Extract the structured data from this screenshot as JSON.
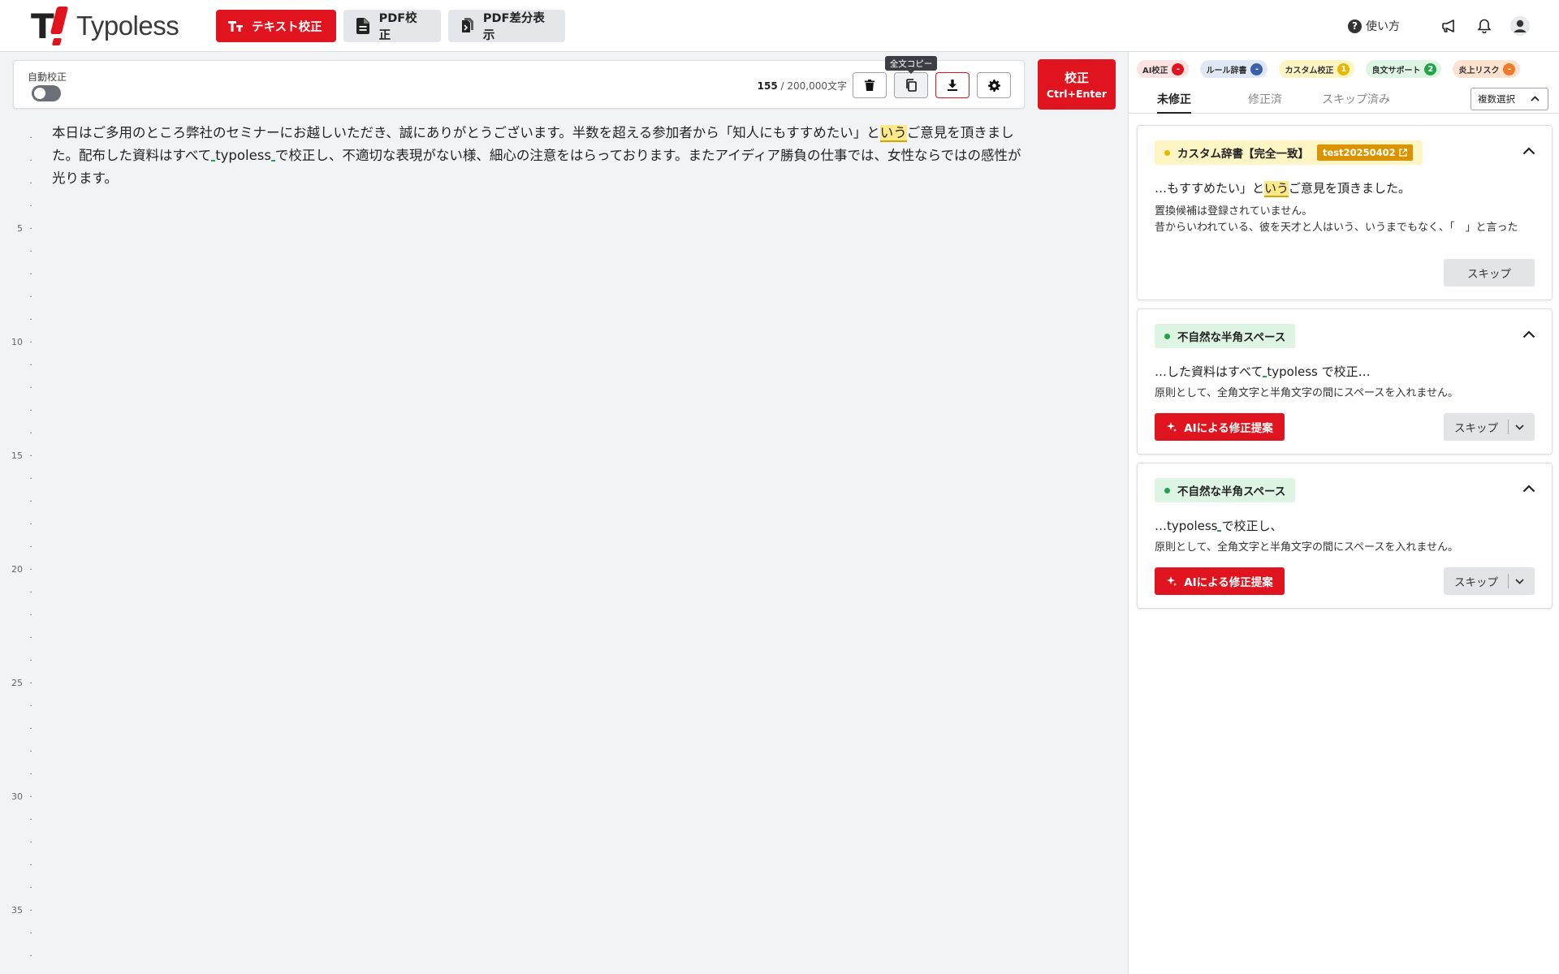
{
  "header": {
    "logo_text": "Typoless",
    "nav": [
      {
        "label": "テキスト校正",
        "icon": "text-proofread-icon"
      },
      {
        "label": "PDF校正",
        "icon": "pdf-file-icon"
      },
      {
        "label": "PDF差分表示",
        "icon": "pdf-diff-icon"
      }
    ],
    "help_label": "使い方"
  },
  "toolbar": {
    "auto_label": "自動校正",
    "auto_enabled": false,
    "char_count": "155",
    "char_limit": "/ 200,000文字",
    "tooltip": "全文コピー",
    "submit_label": "校正",
    "submit_shortcut": "Ctrl+Enter"
  },
  "editor": {
    "line_numbers": [
      "5",
      "10",
      "15",
      "20",
      "25",
      "30",
      "35"
    ],
    "text": {
      "p1": "本日はご多用のところ弊社のセミナーにお越しいただき、誠にありがとうございます。半数を超える参加者から「知人にもすすめたい」と",
      "p1_hl": "いう",
      "p1_rest": "ご意見を頂きまし",
      "p2a": "た。配布した資料はすべて",
      "p2b": "typoless",
      "p2c": "で校正し、不適切な表現がない様、細心の注意をはらっております。またアイディア勝負の仕事では、女性ならではの感性が",
      "p3": "光ります。"
    }
  },
  "panel": {
    "chips": [
      {
        "label": "AI校正",
        "count": "-",
        "bg": "#fde2e2",
        "badge": "#e0141e"
      },
      {
        "label": "ルール辞書",
        "count": "-",
        "bg": "#e1e8f5",
        "badge": "#3b5fa8"
      },
      {
        "label": "カスタム校正",
        "count": "1",
        "bg": "#fdf5c4",
        "badge": "#e6b800"
      },
      {
        "label": "良文サポート",
        "count": "2",
        "bg": "#dff5e3",
        "badge": "#22a34a"
      },
      {
        "label": "炎上リスク",
        "count": "-",
        "bg": "#fde3cf",
        "badge": "#f07a2a"
      }
    ],
    "tabs": [
      "未修正",
      "修正済",
      "スキップ済み"
    ],
    "multi_select": "複数選択",
    "cards": [
      {
        "tag": "カスタム辞書【完全一致】",
        "dict": "test20250402",
        "excerpt_a": "…もすすめたい」と",
        "excerpt_hl": "いう",
        "excerpt_b": "ご意見を頂きました。",
        "note1": "置換候補は登録されていません。",
        "note2": "昔からいわれている、彼を天才と人はいう、いうまでもなく、「　」と言った",
        "skip": "スキップ"
      },
      {
        "tag": "不自然な半角スペース",
        "excerpt_a": "…した資料はすべて",
        "excerpt_b": "typoless で校正…",
        "note": "原則として、全角文字と半角文字の間にスペースを入れません。",
        "ai": "AIによる修正提案",
        "skip": "スキップ"
      },
      {
        "tag": "不自然な半角スペース",
        "excerpt_a": "…typoless",
        "excerpt_b": "で校正し、",
        "note": "原則として、全角文字と半角文字の間にスペースを入れません。",
        "ai": "AIによる修正提案",
        "skip": "スキップ"
      }
    ]
  }
}
